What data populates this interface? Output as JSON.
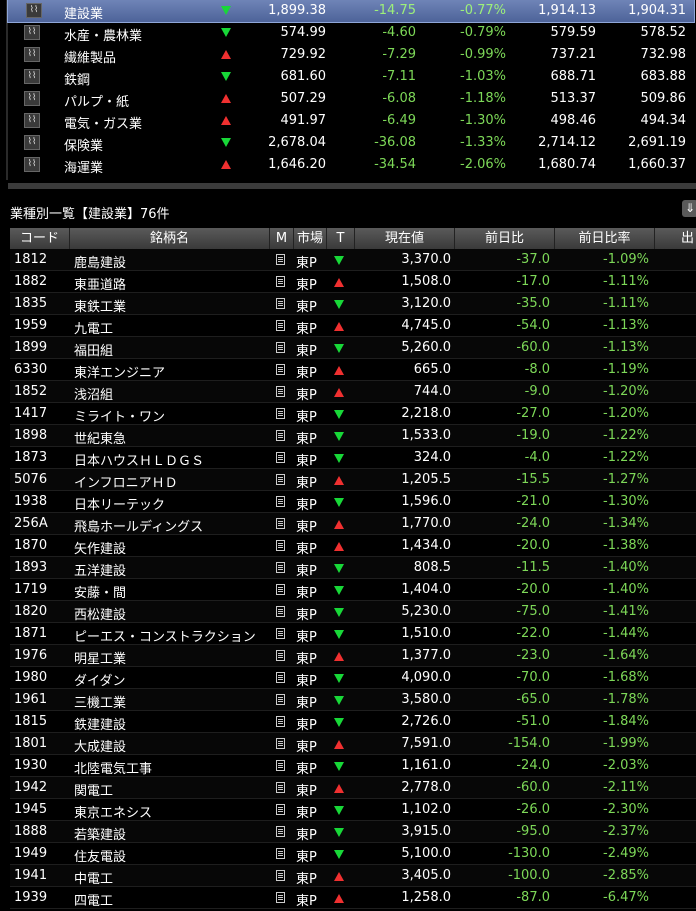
{
  "sectors": [
    {
      "name": "建設業",
      "dir": "down",
      "value": "1,899.38",
      "change": "-14.75",
      "pct": "-0.77%",
      "high": "1,914.13",
      "low": "1,904.31",
      "selected": true
    },
    {
      "name": "水産・農林業",
      "dir": "down",
      "value": "574.99",
      "change": "-4.60",
      "pct": "-0.79%",
      "high": "579.59",
      "low": "578.52"
    },
    {
      "name": "繊維製品",
      "dir": "up",
      "value": "729.92",
      "change": "-7.29",
      "pct": "-0.99%",
      "high": "737.21",
      "low": "732.98"
    },
    {
      "name": "鉄鋼",
      "dir": "down",
      "value": "681.60",
      "change": "-7.11",
      "pct": "-1.03%",
      "high": "688.71",
      "low": "683.88"
    },
    {
      "name": "パルプ・紙",
      "dir": "up",
      "value": "507.29",
      "change": "-6.08",
      "pct": "-1.18%",
      "high": "513.37",
      "low": "509.86"
    },
    {
      "name": "電気・ガス業",
      "dir": "up",
      "value": "491.97",
      "change": "-6.49",
      "pct": "-1.30%",
      "high": "498.46",
      "low": "494.34"
    },
    {
      "name": "保険業",
      "dir": "down",
      "value": "2,678.04",
      "change": "-36.08",
      "pct": "-1.33%",
      "high": "2,714.12",
      "low": "2,691.19"
    },
    {
      "name": "海運業",
      "dir": "up",
      "value": "1,646.20",
      "change": "-34.54",
      "pct": "-2.06%",
      "high": "1,680.74",
      "low": "1,660.37"
    }
  ],
  "list_title": "業種別一覧【建設業】76件",
  "header": {
    "code": "コード",
    "name": "銘柄名",
    "m": "M",
    "market": "市場",
    "t": "T",
    "price": "現在値",
    "change": "前日比",
    "pct": "前日比率",
    "extra": "出"
  },
  "rows": [
    {
      "code": "1812",
      "name": "鹿島建設",
      "market": "東P",
      "dir": "down",
      "price": "3,370.0",
      "change": "-37.0",
      "pct": "-1.09%"
    },
    {
      "code": "1882",
      "name": "東亜道路",
      "market": "東P",
      "dir": "up",
      "price": "1,508.0",
      "change": "-17.0",
      "pct": "-1.11%"
    },
    {
      "code": "1835",
      "name": "東鉄工業",
      "market": "東P",
      "dir": "down",
      "price": "3,120.0",
      "change": "-35.0",
      "pct": "-1.11%"
    },
    {
      "code": "1959",
      "name": "九電工",
      "market": "東P",
      "dir": "up",
      "price": "4,745.0",
      "change": "-54.0",
      "pct": "-1.13%"
    },
    {
      "code": "1899",
      "name": "福田組",
      "market": "東P",
      "dir": "down",
      "price": "5,260.0",
      "change": "-60.0",
      "pct": "-1.13%"
    },
    {
      "code": "6330",
      "name": "東洋エンジニア",
      "market": "東P",
      "dir": "up",
      "price": "665.0",
      "change": "-8.0",
      "pct": "-1.19%"
    },
    {
      "code": "1852",
      "name": "浅沼組",
      "market": "東P",
      "dir": "up",
      "price": "744.0",
      "change": "-9.0",
      "pct": "-1.20%"
    },
    {
      "code": "1417",
      "name": "ミライト・ワン",
      "market": "東P",
      "dir": "down",
      "price": "2,218.0",
      "change": "-27.0",
      "pct": "-1.20%"
    },
    {
      "code": "1898",
      "name": "世紀東急",
      "market": "東P",
      "dir": "down",
      "price": "1,533.0",
      "change": "-19.0",
      "pct": "-1.22%"
    },
    {
      "code": "1873",
      "name": "日本ハウスＨＬＤＧＳ",
      "market": "東P",
      "dir": "down",
      "price": "324.0",
      "change": "-4.0",
      "pct": "-1.22%"
    },
    {
      "code": "5076",
      "name": "インフロニアＨＤ",
      "market": "東P",
      "dir": "up",
      "price": "1,205.5",
      "change": "-15.5",
      "pct": "-1.27%"
    },
    {
      "code": "1938",
      "name": "日本リーテック",
      "market": "東P",
      "dir": "down",
      "price": "1,596.0",
      "change": "-21.0",
      "pct": "-1.30%"
    },
    {
      "code": "256A",
      "name": "飛島ホールディングス",
      "market": "東P",
      "dir": "up",
      "price": "1,770.0",
      "change": "-24.0",
      "pct": "-1.34%"
    },
    {
      "code": "1870",
      "name": "矢作建設",
      "market": "東P",
      "dir": "up",
      "price": "1,434.0",
      "change": "-20.0",
      "pct": "-1.38%"
    },
    {
      "code": "1893",
      "name": "五洋建設",
      "market": "東P",
      "dir": "down",
      "price": "808.5",
      "change": "-11.5",
      "pct": "-1.40%"
    },
    {
      "code": "1719",
      "name": "安藤・間",
      "market": "東P",
      "dir": "down",
      "price": "1,404.0",
      "change": "-20.0",
      "pct": "-1.40%"
    },
    {
      "code": "1820",
      "name": "西松建設",
      "market": "東P",
      "dir": "down",
      "price": "5,230.0",
      "change": "-75.0",
      "pct": "-1.41%"
    },
    {
      "code": "1871",
      "name": "ピーエス・コンストラクション",
      "market": "東P",
      "dir": "down",
      "price": "1,510.0",
      "change": "-22.0",
      "pct": "-1.44%"
    },
    {
      "code": "1976",
      "name": "明星工業",
      "market": "東P",
      "dir": "up",
      "price": "1,377.0",
      "change": "-23.0",
      "pct": "-1.64%"
    },
    {
      "code": "1980",
      "name": "ダイダン",
      "market": "東P",
      "dir": "down",
      "price": "4,090.0",
      "change": "-70.0",
      "pct": "-1.68%"
    },
    {
      "code": "1961",
      "name": "三機工業",
      "market": "東P",
      "dir": "down",
      "price": "3,580.0",
      "change": "-65.0",
      "pct": "-1.78%"
    },
    {
      "code": "1815",
      "name": "鉄建建設",
      "market": "東P",
      "dir": "down",
      "price": "2,726.0",
      "change": "-51.0",
      "pct": "-1.84%"
    },
    {
      "code": "1801",
      "name": "大成建設",
      "market": "東P",
      "dir": "up",
      "price": "7,591.0",
      "change": "-154.0",
      "pct": "-1.99%"
    },
    {
      "code": "1930",
      "name": "北陸電気工事",
      "market": "東P",
      "dir": "down",
      "price": "1,161.0",
      "change": "-24.0",
      "pct": "-2.03%"
    },
    {
      "code": "1942",
      "name": "関電工",
      "market": "東P",
      "dir": "up",
      "price": "2,778.0",
      "change": "-60.0",
      "pct": "-2.11%"
    },
    {
      "code": "1945",
      "name": "東京エネシス",
      "market": "東P",
      "dir": "down",
      "price": "1,102.0",
      "change": "-26.0",
      "pct": "-2.30%"
    },
    {
      "code": "1888",
      "name": "若築建設",
      "market": "東P",
      "dir": "down",
      "price": "3,915.0",
      "change": "-95.0",
      "pct": "-2.37%"
    },
    {
      "code": "1949",
      "name": "住友電設",
      "market": "東P",
      "dir": "down",
      "price": "5,100.0",
      "change": "-130.0",
      "pct": "-2.49%"
    },
    {
      "code": "1941",
      "name": "中電工",
      "market": "東P",
      "dir": "up",
      "price": "3,405.0",
      "change": "-100.0",
      "pct": "-2.85%"
    },
    {
      "code": "1939",
      "name": "四電工",
      "market": "東P",
      "dir": "up",
      "price": "1,258.0",
      "change": "-87.0",
      "pct": "-6.47%"
    }
  ],
  "colors": {
    "up": "#f03030",
    "down": "#18d838",
    "negative": "#7dd858",
    "selected": "#5a70a8"
  }
}
